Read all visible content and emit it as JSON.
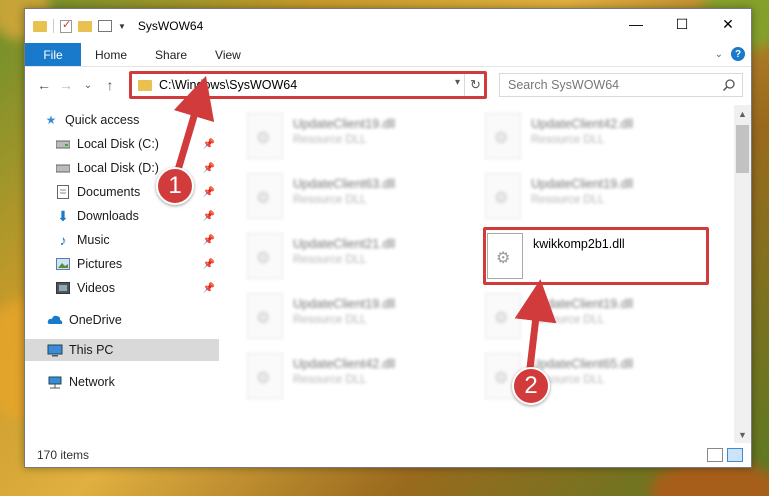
{
  "window": {
    "title": "SysWOW64",
    "controls": {
      "minimize": "—",
      "maximize": "☐",
      "close": "✕"
    }
  },
  "ribbon": {
    "tabs": [
      "File",
      "Home",
      "Share",
      "View"
    ]
  },
  "navbar": {
    "back": "←",
    "forward": "→",
    "recent": "⌄",
    "up": "↑",
    "address": "C:\\Windows\\SysWOW64",
    "search_placeholder": "Search SysWOW64"
  },
  "sidebar": {
    "items": [
      {
        "label": "Quick access",
        "icon": "star-icon",
        "pinned": false
      },
      {
        "label": "Local Disk (C:)",
        "icon": "drive-icon",
        "pinned": true
      },
      {
        "label": "Local Disk (D:)",
        "icon": "drive-icon",
        "pinned": true
      },
      {
        "label": "Documents",
        "icon": "document-icon",
        "pinned": true
      },
      {
        "label": "Downloads",
        "icon": "download-icon",
        "pinned": true
      },
      {
        "label": "Music",
        "icon": "music-icon",
        "pinned": true
      },
      {
        "label": "Pictures",
        "icon": "pictures-icon",
        "pinned": true
      },
      {
        "label": "Videos",
        "icon": "videos-icon",
        "pinned": true
      },
      {
        "label": "OneDrive",
        "icon": "cloud-icon",
        "pinned": false
      },
      {
        "label": "This PC",
        "icon": "computer-icon",
        "pinned": false,
        "selected": true
      },
      {
        "label": "Network",
        "icon": "network-icon",
        "pinned": false
      }
    ]
  },
  "files": [
    {
      "name": "UpdateClient19.dll",
      "type": "Resource DLL"
    },
    {
      "name": "UpdateClient42.dll",
      "type": "Resource DLL"
    },
    {
      "name": "UpdateClient63.dll",
      "type": "Resource DLL"
    },
    {
      "name": "UpdateClient19.dll",
      "type": "Resource DLL"
    },
    {
      "name": "UpdateClient21.dll",
      "type": "Resource DLL"
    },
    {
      "name": "kwikkomp2b1.dll",
      "type": ""
    },
    {
      "name": "UpdateClient19.dll",
      "type": "Resource DLL"
    },
    {
      "name": "UpdateClient19.dll",
      "type": "Resource DLL"
    },
    {
      "name": "UpdateClient42.dll",
      "type": "Resource DLL"
    },
    {
      "name": "UpdateClient65.dll",
      "type": "Resource DLL"
    }
  ],
  "status": {
    "item_count": "170 items"
  },
  "callouts": {
    "one": "1",
    "two": "2"
  },
  "colors": {
    "accent": "#1979ca",
    "highlight": "#d23b3b"
  }
}
